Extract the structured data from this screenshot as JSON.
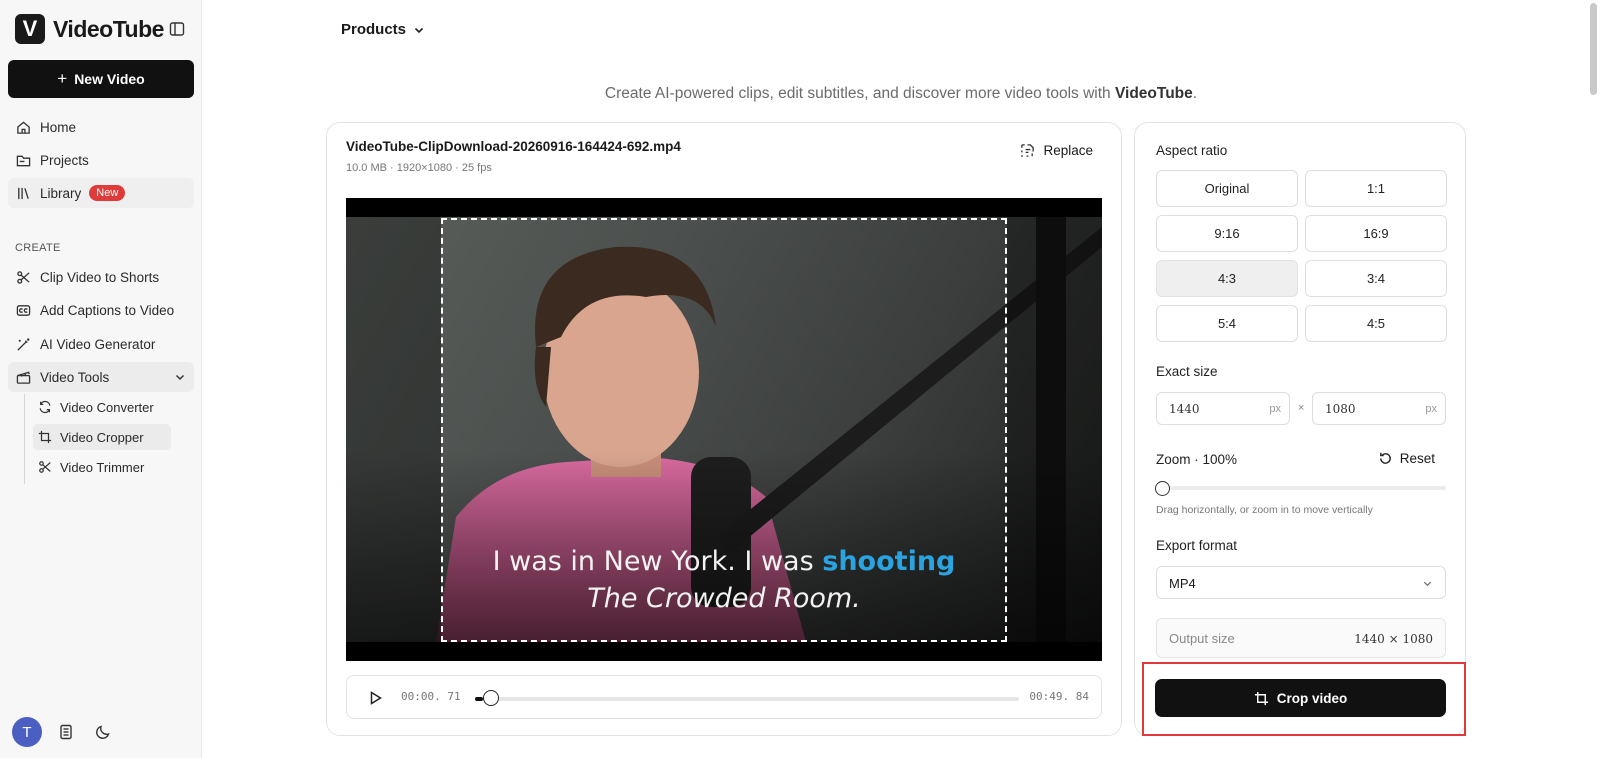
{
  "brand": {
    "logo_letter": "V",
    "name": "VideoTube"
  },
  "sidebar": {
    "new_video_label": "New Video",
    "nav": [
      {
        "label": "Home",
        "icon": "home-icon"
      },
      {
        "label": "Projects",
        "icon": "folder-icon"
      },
      {
        "label": "Library",
        "icon": "library-icon",
        "badge": "New"
      }
    ],
    "create_section_label": "CREATE",
    "create_items": [
      {
        "label": "Clip Video to Shorts",
        "icon": "scissors-icon"
      },
      {
        "label": "Add Captions to Video",
        "icon": "captions-icon"
      },
      {
        "label": "AI Video Generator",
        "icon": "magic-wand-icon"
      },
      {
        "label": "Video Tools",
        "icon": "clapperboard-icon",
        "expanded": true
      }
    ],
    "video_tools": [
      {
        "label": "Video Converter",
        "icon": "refresh-icon"
      },
      {
        "label": "Video Cropper",
        "icon": "crop-icon",
        "selected": true
      },
      {
        "label": "Video Trimmer",
        "icon": "scissors-icon"
      }
    ],
    "user_initial": "T"
  },
  "header": {
    "products_label": "Products"
  },
  "tagline": {
    "prefix": "Create AI-powered clips, edit subtitles, and discover more video tools with ",
    "brand": "VideoTube",
    "suffix": "."
  },
  "video": {
    "file_name": "VideoTube-ClipDownload-20260916-164424-692.mp4",
    "meta": "10.0 MB · 1920×1080 · 25 fps",
    "replace_label": "Replace",
    "subtitle_line1_plain": "I was in New York. I was ",
    "subtitle_line1_highlight": "shooting",
    "subtitle_line2": "The Crowded Room.",
    "current_time": "00:00. 71",
    "duration": "00:49. 84",
    "progress_fraction": 0.014
  },
  "panel": {
    "aspect_ratio_label": "Aspect ratio",
    "ratios": [
      "Original",
      "1:1",
      "9:16",
      "16:9",
      "4:3",
      "3:4",
      "5:4",
      "4:5"
    ],
    "selected_ratio": "4:3",
    "exact_size_label": "Exact size",
    "width_value": "1440",
    "height_value": "1080",
    "unit": "px",
    "times_symbol": "×",
    "zoom_label": "Zoom · 100%",
    "zoom_fraction": 0.0,
    "reset_label": "Reset",
    "zoom_hint": "Drag horizontally, or zoom in to move vertically",
    "export_format_label": "Export format",
    "export_format_value": "MP4",
    "output_size_label": "Output size",
    "output_size_value": "1440 × 1080",
    "crop_button_label": "Crop video"
  },
  "colors": {
    "accent_dark": "#111111",
    "badge_red": "#e03b3b",
    "subtitle_highlight": "#2aa4e0",
    "highlight_border": "#e0393a"
  }
}
